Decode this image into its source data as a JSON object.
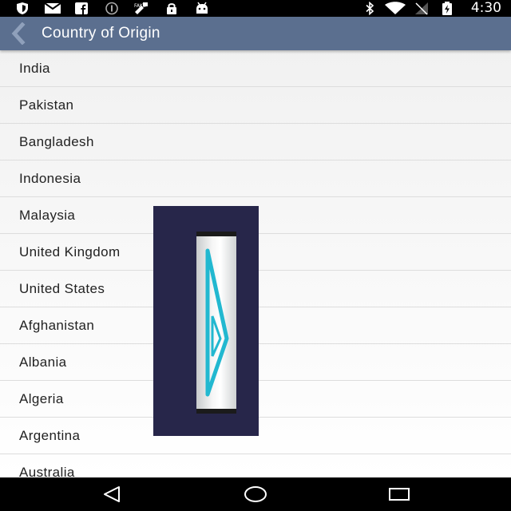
{
  "status_bar": {
    "time": "4:30",
    "left_icons": [
      "shield-icon",
      "mail-icon",
      "facebook-icon",
      "sync-icon",
      "satellite-icon",
      "lock-icon",
      "android-icon"
    ],
    "right_icons": [
      "bluetooth-icon",
      "wifi-icon",
      "no-signal-icon",
      "battery-icon"
    ]
  },
  "app_bar": {
    "title": "Country of Origin",
    "back_icon": "back-chevron-icon",
    "color": "#5b6f8f"
  },
  "countries": [
    "India",
    "Pakistan",
    "Bangladesh",
    "Indonesia",
    "Malaysia",
    "United Kingdom",
    "United States",
    "Afghanistan",
    "Albania",
    "Algeria",
    "Argentina",
    "Australia"
  ],
  "overlay": {
    "icon": "play-triangle-icon",
    "background": "#27264a",
    "accent": "#22b8d0"
  },
  "nav_bar": {
    "icons": [
      "back-triangle-icon",
      "home-circle-icon",
      "recents-square-icon"
    ]
  }
}
